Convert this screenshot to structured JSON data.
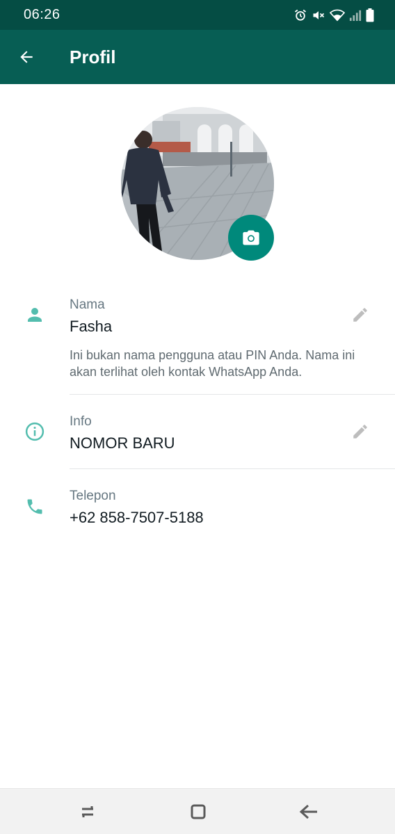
{
  "status_bar": {
    "time": "06:26",
    "icons": [
      "alarm-icon",
      "mute-icon",
      "wifi-icon",
      "signal-icon",
      "battery-icon"
    ]
  },
  "app_bar": {
    "title": "Profil",
    "back_icon": "arrow-left-icon",
    "background": "#075e54"
  },
  "profile": {
    "photo": "profile-photo",
    "camera_icon": "camera-icon",
    "accent": "#00897b"
  },
  "fields": {
    "name": {
      "label": "Nama",
      "value": "Fasha",
      "helper": "Ini bukan nama pengguna atau PIN Anda. Nama ini akan terlihat oleh kontak WhatsApp Anda."
    },
    "about": {
      "label": "Info",
      "value": "NOMOR BARU"
    },
    "phone": {
      "label": "Telepon",
      "value": "+62 858-7507-5188"
    }
  },
  "nav_bar": {
    "buttons": [
      "recent-apps-icon",
      "home-icon",
      "back-icon"
    ]
  }
}
